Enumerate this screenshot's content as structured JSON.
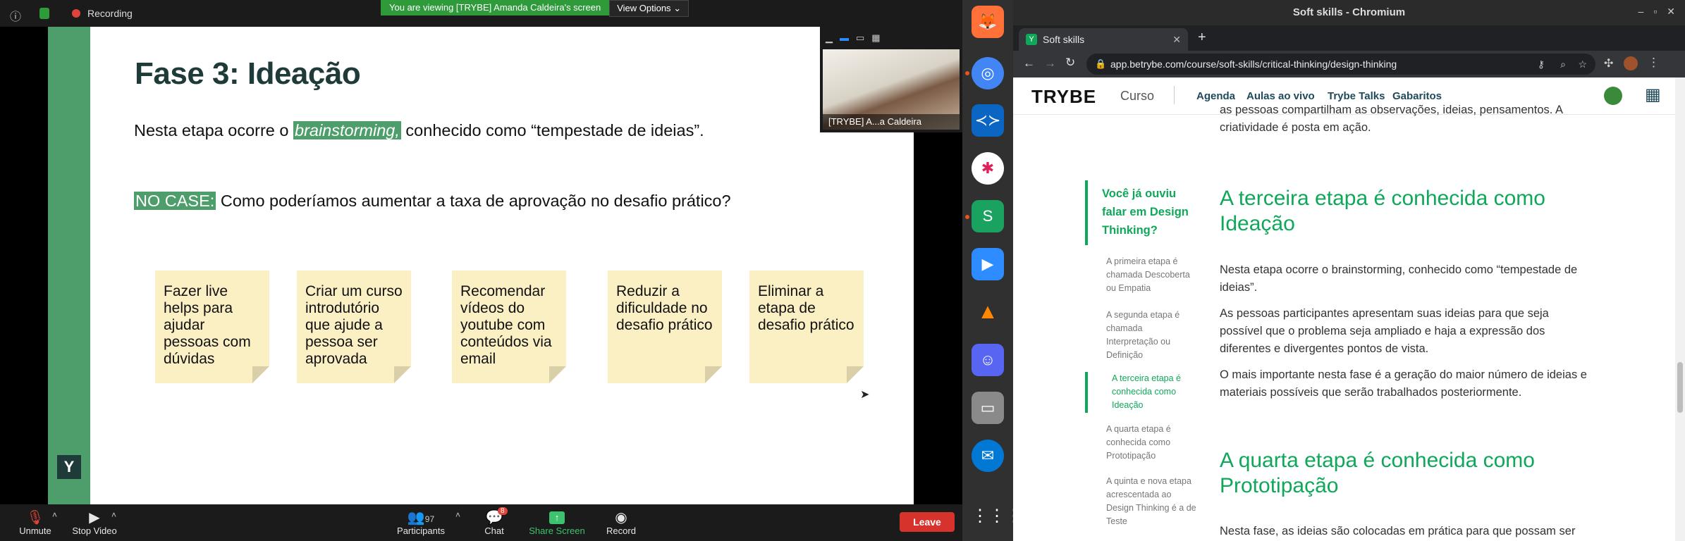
{
  "zoom": {
    "recording_label": "Recording",
    "viewing_banner": "You are viewing [TRYBE] Amanda Caldeira's screen",
    "view_options": "View Options",
    "participant_name": "[TRYBE] A...a Caldeira",
    "participants_count": "97",
    "chat_badge": "8",
    "controls": {
      "unmute": "Unmute",
      "stop_video": "Stop Video",
      "participants": "Participants",
      "chat": "Chat",
      "share_screen": "Share Screen",
      "record": "Record",
      "leave": "Leave"
    }
  },
  "slide": {
    "title": "Fase 3: Ideação",
    "line1_pre": "Nesta etapa ocorre o ",
    "line1_hl": "brainstorming,",
    "line1_post": " conhecido como “tempestade de ideias”.",
    "case_label": "NO CASE:",
    "case_text": " Como poderíamos aumentar a taxa de aprovação no desafio prático?",
    "notes": [
      "Fazer live helps para ajudar pessoas com dúvidas",
      "Criar um curso introdutório que ajude a pessoa ser aprovada",
      "Recomendar vídeos do youtube com conteúdos via email",
      "Reduzir a dificuldade no desafio prático",
      "Eliminar a etapa de desafio prático"
    ],
    "logo": "Y"
  },
  "browser": {
    "window_title": "Soft skills - Chromium",
    "tab_title": "Soft skills",
    "url": "app.betrybe.com/course/soft-skills/critical-thinking/design-thinking"
  },
  "site": {
    "logo": "TRYBE",
    "curso": "Curso",
    "nav": [
      "Agenda",
      "Aulas ao vivo",
      "Trybe Talks",
      "Gabaritos"
    ]
  },
  "toc": {
    "heading": "Você já ouviu falar em Design Thinking?",
    "items": [
      "A primeira etapa é chamada Descoberta ou Empatia",
      "A segunda etapa é chamada Interpretação ou Definição",
      "A terceira etapa é conhecida como Ideação",
      "A quarta etapa é conhecida como Prototipação",
      "A quinta e nova etapa acrescentada ao Design Thinking é a de Teste"
    ]
  },
  "article": {
    "top_text": "as pessoas compartilham as observações, ideias, pensamentos. A criatividade é posta em ação.",
    "h2_ideacao": "A terceira etapa é conhecida como Ideação",
    "p1": "Nesta etapa ocorre o brainstorming, conhecido como “tempestade de ideias”.",
    "p2": "As pessoas participantes apresentam suas ideias para que seja possível que o problema seja ampliado e haja a expressão dos diferentes e divergentes pontos de vista.",
    "p3": "O mais importante nesta fase é a geração do maior número de ideias e materiais possíveis que serão trabalhados posteriormente.",
    "h2_prototipacao": "A quarta etapa é conhecida como Prototipação",
    "p4": "Nesta fase, as ideias são colocadas em prática para que possam ser"
  }
}
